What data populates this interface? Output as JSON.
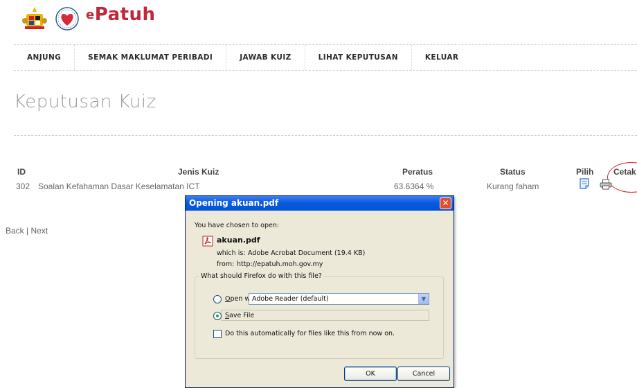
{
  "header": {
    "brand_prefix": "e",
    "brand_name": "Patuh"
  },
  "nav": {
    "items": [
      "ANJUNG",
      "SEMAK MAKLUMAT PERIBADI",
      "JAWAB KUIZ",
      "LIHAT KEPUTUSAN",
      "KELUAR"
    ]
  },
  "page": {
    "title": "Keputusan Kuiz"
  },
  "table": {
    "headers": {
      "id": "ID",
      "jenis": "Jenis Kuiz",
      "peratus": "Peratus",
      "status": "Status",
      "pilih": "Pilih",
      "cetak": "Cetak"
    },
    "rows": [
      {
        "id": "302",
        "jenis": "Soalan Kefahaman Dasar Keselamatan ICT",
        "peratus": "63.6364 %",
        "status": "Kurang faham"
      }
    ]
  },
  "pager": {
    "back": "Back",
    "separator": " | ",
    "next": "Next"
  },
  "dialog": {
    "title": "Opening akuan.pdf",
    "intro": "You have chosen to open:",
    "filename": "akuan.pdf",
    "which_is_label": "which is:",
    "which_is_value": "Adobe Acrobat Document (19.4 KB)",
    "from_label": "from:",
    "from_value": "http://epatuh.moh.gov.my",
    "question": "What should Firefox do with this file?",
    "open_with_label": "Open with",
    "open_with_app": "Adobe Reader  (default)",
    "save_file_label": "Save File",
    "auto_label": "Do this automatically for files like this from now on.",
    "ok": "OK",
    "cancel": "Cancel",
    "selected_option": "save_file"
  },
  "colors": {
    "brand": "#c0283a",
    "titlebar": "#0a5ae0",
    "highlight_circle": "#e0222a"
  },
  "icons": [
    "malaysia-crest-icon",
    "heart-logo-icon",
    "document-icon",
    "printer-icon",
    "pdf-icon",
    "close-icon",
    "dropdown-arrow-icon"
  ]
}
